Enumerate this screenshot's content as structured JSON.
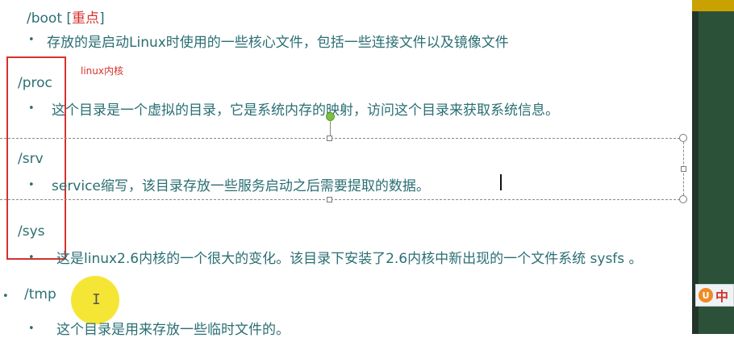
{
  "entries": [
    {
      "dir": "/boot",
      "tag_open": "[",
      "tag_text": "重点",
      "tag_close": "]",
      "desc": "存放的是启动Linux时使用的一些核心文件，包括一些连接文件以及镜像文件"
    },
    {
      "dir": "/proc",
      "desc": "这个目录是一个虚拟的目录，它是系统内存的映射，访问这个目录来获取系统信息。"
    },
    {
      "dir": "/srv",
      "desc": "service缩写，该目录存放一些服务启动之后需要提取的数据。"
    },
    {
      "dir": "/sys",
      "desc": "这是linux2.6内核的一个很大的变化。该目录下安装了2.6内核中新出现的一个文件系统 sysfs 。"
    },
    {
      "dir": "/tmp",
      "desc": "这个目录是用来存放一些临时文件的。"
    }
  ],
  "annotation": {
    "label": "linux内核",
    "color": "#d6322b"
  },
  "bullet_glyph": "•",
  "ime": {
    "char": "中",
    "logo": "U"
  },
  "colors": {
    "text": "#2a6e73",
    "accent": "#d6322b",
    "highlight": "#f4e52a"
  }
}
